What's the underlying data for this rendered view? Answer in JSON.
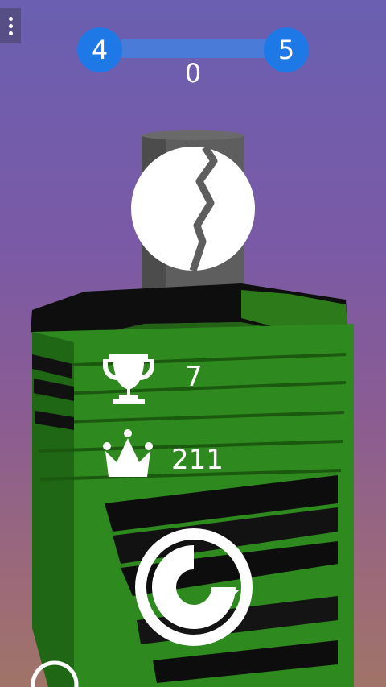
{
  "hud": {
    "current_level": "4",
    "next_level": "5",
    "score": "0",
    "level_progress": 0.0
  },
  "stats": {
    "best_level": "7",
    "high_score": "211"
  },
  "icons": {
    "menu": "more-vertical-icon",
    "trophy": "trophy-icon",
    "crown": "crown-icon",
    "restart": "restart-icon",
    "ball": "cracked-ball-icon"
  },
  "colors": {
    "level_circle": "#1e78e6",
    "tower_green": "#2f8a1e",
    "tower_black": "#111111",
    "pole": "#5a5a5a"
  }
}
